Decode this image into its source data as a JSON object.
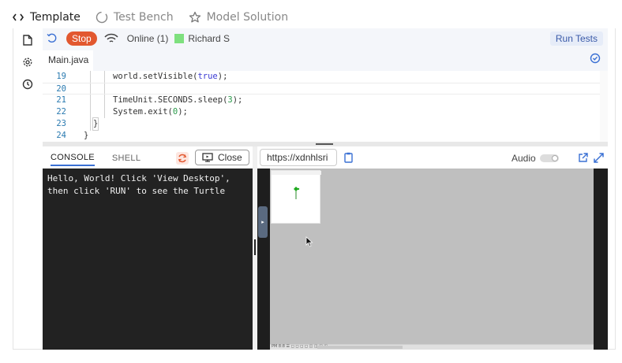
{
  "top_tabs": [
    {
      "label": "Template",
      "icon": "code-icon",
      "active": true
    },
    {
      "label": "Test Bench",
      "icon": "circle-icon",
      "active": false
    },
    {
      "label": "Model Solution",
      "icon": "star-icon",
      "active": false
    }
  ],
  "rail": {
    "icons": [
      "file-icon",
      "gear-icon",
      "clock-icon"
    ]
  },
  "toolbar": {
    "stop_label": "Stop",
    "online_text": "Online (1)",
    "user_name": "Richard S",
    "user_color": "#7ee07e",
    "run_tests_label": "Run Tests",
    "stop_color": "#e2582f"
  },
  "file_tab": {
    "label": "Main.java"
  },
  "code": {
    "lines": [
      {
        "num": "19",
        "text": "world.setVisible(true);"
      },
      {
        "num": "20",
        "text": ""
      },
      {
        "num": "21",
        "text": "TimeUnit.SECONDS.sleep(3);"
      },
      {
        "num": "22",
        "text": "System.exit(0);"
      },
      {
        "num": "23",
        "text": "}"
      },
      {
        "num": "24",
        "text": "}"
      }
    ]
  },
  "console": {
    "tabs": [
      "CONSOLE",
      "SHELL"
    ],
    "close_label": "Close",
    "output": "Hello, World! Click 'View Desktop',\nthen click 'RUN' to see the Turtle"
  },
  "desktop": {
    "url": "https://xdnhlsri",
    "audio_label": "Audio",
    "audio_on": false,
    "taskbar_text": "PM 8:8 ☰ ◻ ◻ ◻ ◻ ◫ ◫ ◫ ◫"
  },
  "colors": {
    "accent": "#3a70d4",
    "console_bg": "#222222",
    "desktop_bg": "#bfbfbf"
  }
}
